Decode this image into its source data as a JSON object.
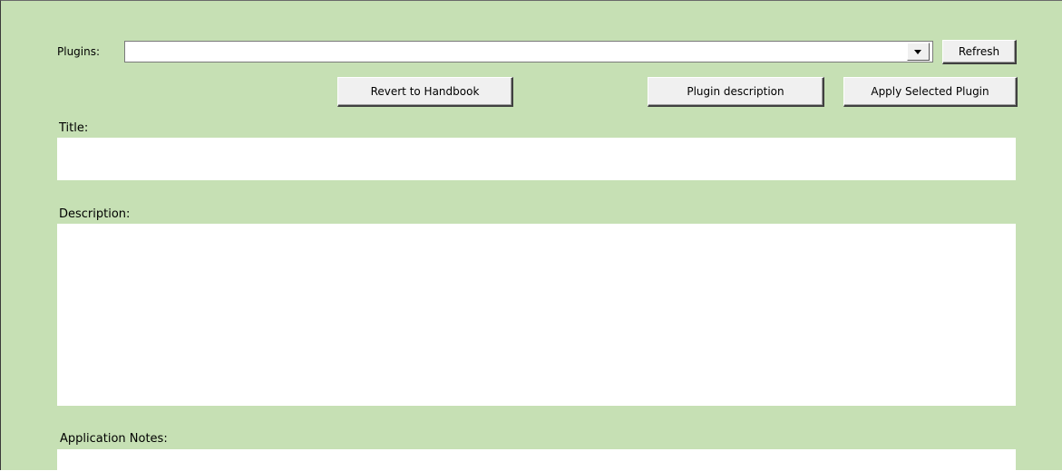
{
  "plugins": {
    "label": "Plugins:",
    "selected_value": "",
    "refresh_label": "Refresh"
  },
  "actions": {
    "revert_label": "Revert to Handbook",
    "description_label": "Plugin description",
    "apply_label": "Apply Selected Plugin"
  },
  "fields": {
    "title_label": "Title:",
    "title_value": "",
    "description_label": "Description:",
    "description_value": "",
    "notes_label": "Application Notes:",
    "notes_value": ""
  },
  "colors": {
    "panel_background": "#c6e0b4",
    "field_background": "#ffffff",
    "button_face": "#f0f0f0"
  },
  "icons": {
    "dropdown": "chevron-down-icon"
  }
}
